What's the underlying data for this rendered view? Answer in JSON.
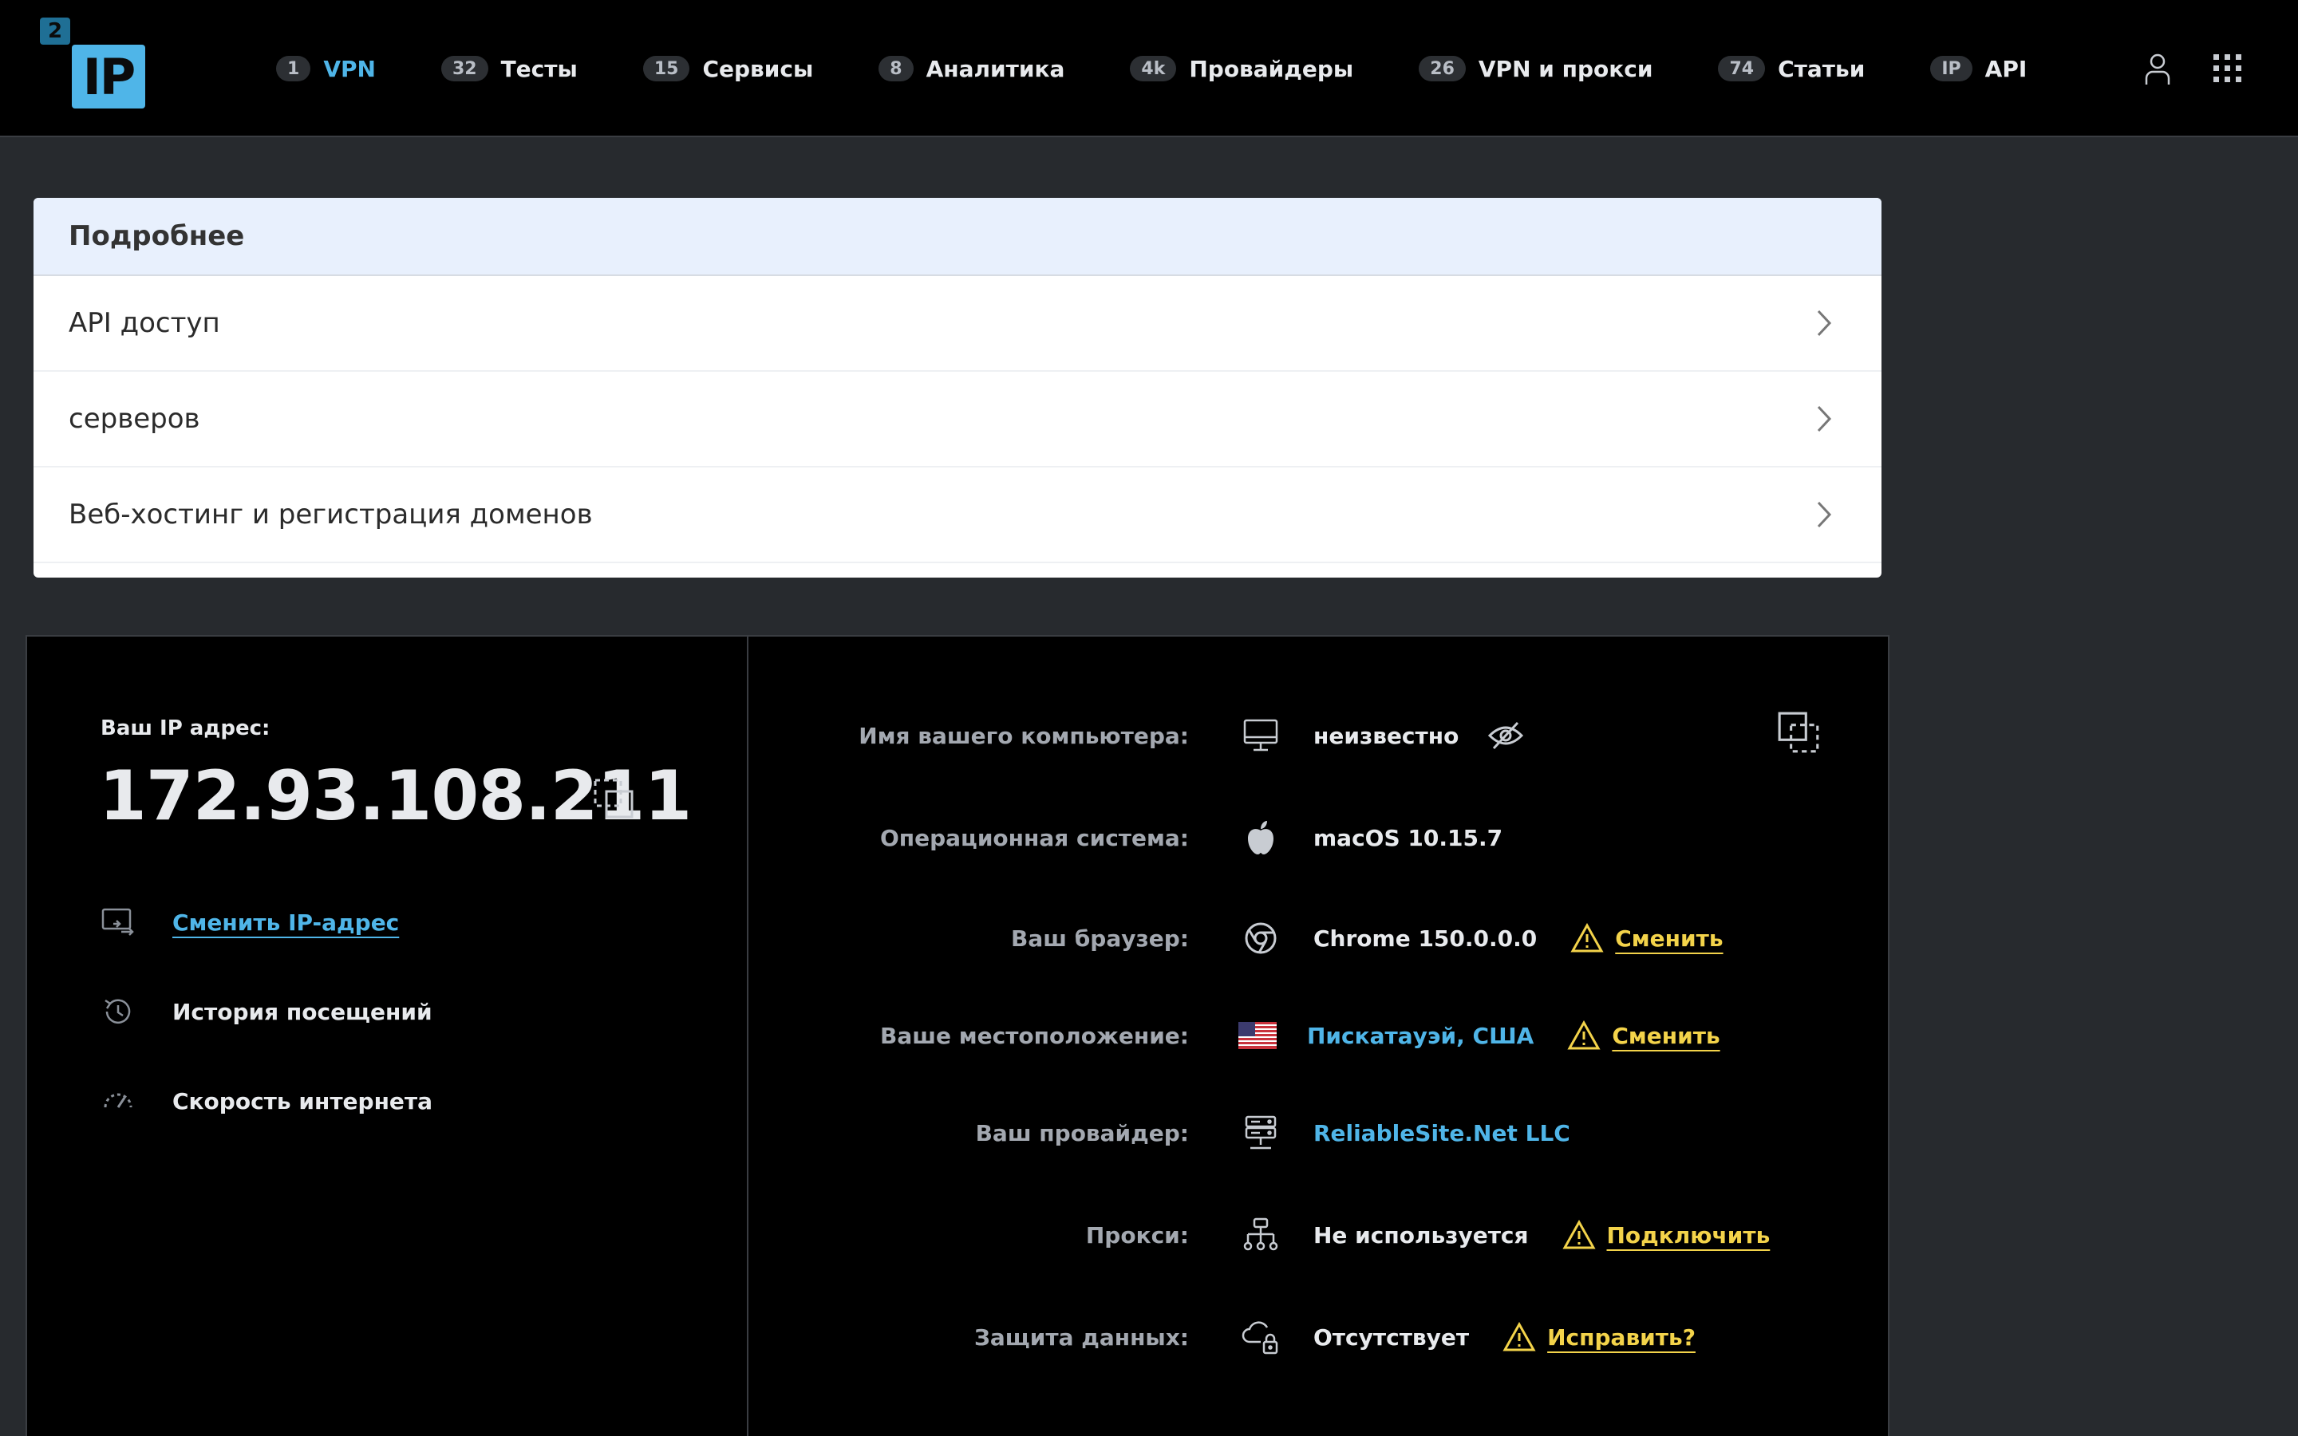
{
  "logo": {
    "badge": "2",
    "text": "IP"
  },
  "nav": {
    "items": [
      {
        "badge": "1",
        "label": "VPN"
      },
      {
        "badge": "32",
        "label": "Тесты"
      },
      {
        "badge": "15",
        "label": "Сервисы"
      },
      {
        "badge": "8",
        "label": "Аналитика"
      },
      {
        "badge": "4k",
        "label": "Провайдеры"
      },
      {
        "badge": "26",
        "label": "VPN и прокси"
      },
      {
        "badge": "74",
        "label": "Статьи"
      },
      {
        "badge": "IP",
        "label": "API"
      }
    ]
  },
  "details": {
    "title": "Подробнее",
    "rows": [
      "API доступ",
      "серверов",
      "Веб-хостинг и регистрация доменов"
    ]
  },
  "ip_panel": {
    "caption": "Ваш IP адрес:",
    "ip": "172.93.108.211",
    "actions": [
      "Сменить IP-адрес",
      "История посещений",
      "Скорость интернета"
    ]
  },
  "info": {
    "computer": {
      "label": "Имя вашего компьютера:",
      "value": "неизвестно"
    },
    "os": {
      "label": "Операционная система:",
      "value": "macOS 10.15.7"
    },
    "browser": {
      "label": "Ваш браузер:",
      "value": "Chrome 150.0.0.0",
      "action": "Сменить"
    },
    "location": {
      "label": "Ваше местоположение:",
      "value": "Пискатауэй, США",
      "action": "Сменить"
    },
    "provider": {
      "label": "Ваш провайдер:",
      "value": "ReliableSite.Net LLC"
    },
    "proxy": {
      "label": "Прокси:",
      "value": "Не используется",
      "action": "Подключить"
    },
    "protection": {
      "label": "Защита данных:",
      "value": "Отсутствует",
      "action": "Исправить?"
    }
  },
  "colors": {
    "accent": "#4fb5e8",
    "warning": "#f3d34a",
    "background": "#272a2e",
    "panel": "#000000"
  }
}
